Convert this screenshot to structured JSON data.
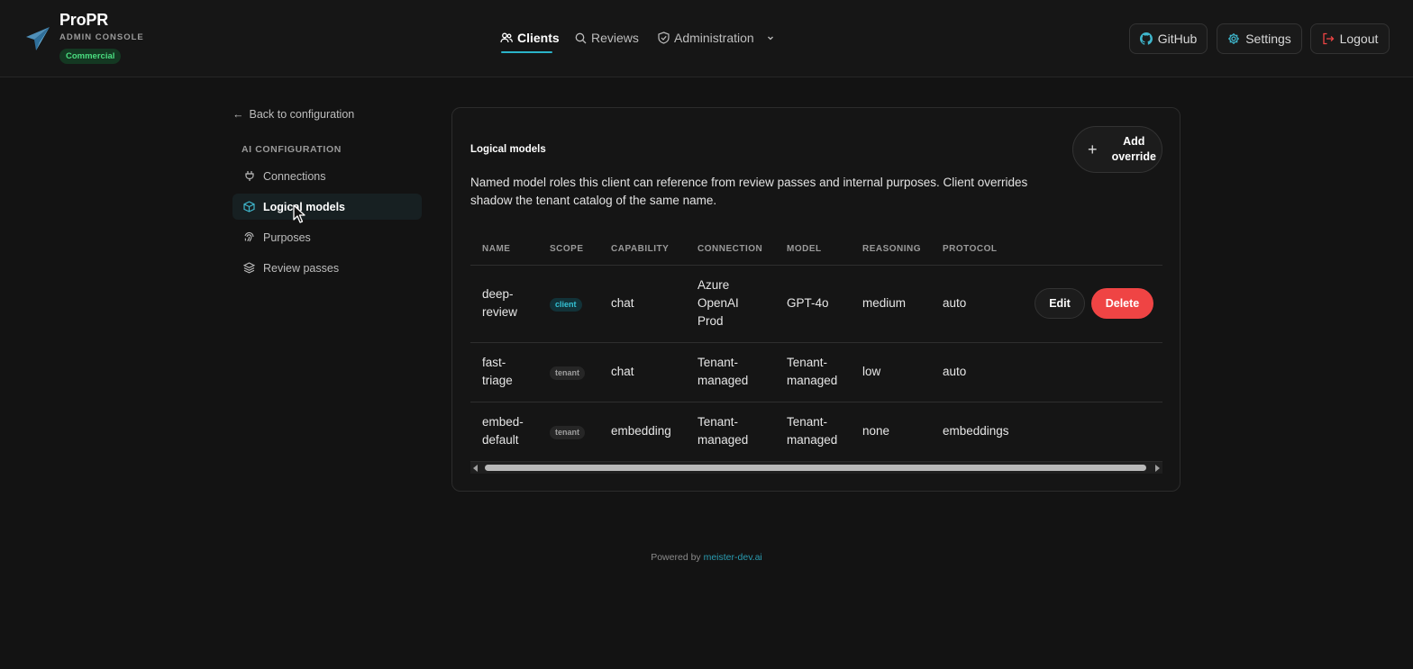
{
  "app": {
    "name": "ProPR",
    "subtitle": "ADMIN CONSOLE",
    "edition_badge": "Commercial"
  },
  "nav": {
    "clients": "Clients",
    "reviews": "Reviews",
    "administration": "Administration"
  },
  "header_actions": {
    "github": "GitHub",
    "settings": "Settings",
    "logout": "Logout"
  },
  "sidebar": {
    "back_link": "Back to configuration",
    "section_title": "AI CONFIGURATION",
    "items": [
      {
        "label": "Connections",
        "icon": "plug-icon"
      },
      {
        "label": "Logical models",
        "icon": "cube-icon",
        "active": true
      },
      {
        "label": "Purposes",
        "icon": "fingerprint-icon"
      },
      {
        "label": "Review passes",
        "icon": "layers-icon"
      }
    ]
  },
  "card": {
    "title": "Logical models",
    "add_button": "Add override",
    "description": "Named model roles this client can reference from review passes and internal purposes. Client overrides shadow the tenant catalog of the same name."
  },
  "table": {
    "columns": [
      "NAME",
      "SCOPE",
      "CAPABILITY",
      "CONNECTION",
      "MODEL",
      "REASONING",
      "PROTOCOL"
    ],
    "rows": [
      {
        "name": "deep-review",
        "scope": "client",
        "capability": "chat",
        "connection": "Azure OpenAI Prod",
        "model": "GPT-4o",
        "reasoning": "medium",
        "protocol": "auto",
        "edit": "Edit",
        "delete": "Delete"
      },
      {
        "name": "fast-triage",
        "scope": "tenant",
        "capability": "chat",
        "connection": "Tenant-managed",
        "model": "Tenant-managed",
        "reasoning": "low",
        "protocol": "auto"
      },
      {
        "name": "embed-default",
        "scope": "tenant",
        "capability": "embedding",
        "connection": "Tenant-managed",
        "model": "Tenant-managed",
        "reasoning": "none",
        "protocol": "embeddings"
      }
    ]
  },
  "footer": {
    "prefix": "Powered by",
    "link": "meister-dev.ai"
  },
  "colors": {
    "accent": "#2bb3c9",
    "danger": "#ef4444",
    "success": "#4ade80",
    "background": "#131313"
  }
}
